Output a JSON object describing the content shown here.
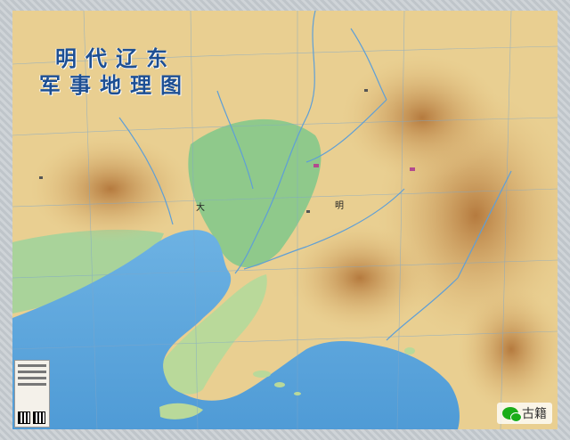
{
  "map": {
    "title_line1": "明代辽东",
    "title_line2": "军事地理图",
    "labels": {
      "da": "大",
      "ming": "明"
    }
  },
  "colors": {
    "sea": "#5fa7dd",
    "plain": "#8fc98b",
    "highland": "#e6c688",
    "mountain": "#c48a4b",
    "river": "#5f9fd6",
    "title": "#1d4f93"
  },
  "watermark": {
    "icon": "wechat-icon",
    "text": "古籍"
  },
  "legend": {
    "icon": "qr-code-icon"
  }
}
